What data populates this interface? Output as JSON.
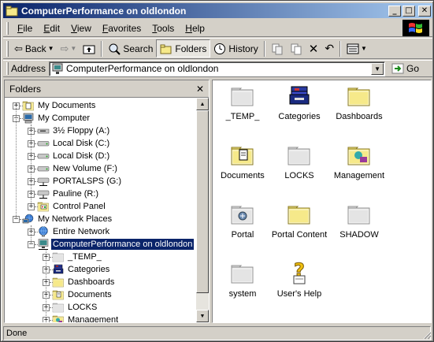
{
  "window": {
    "title": "ComputerPerformance on oldlondon",
    "minimize_glyph": "_",
    "maximize_glyph": "□",
    "close_glyph": "✕"
  },
  "menubar": {
    "items": [
      "File",
      "Edit",
      "View",
      "Favorites",
      "Tools",
      "Help"
    ],
    "underlined_letters": [
      "F",
      "E",
      "V",
      "a",
      "T",
      "H"
    ]
  },
  "toolbar": {
    "back_label": "Back",
    "search_label": "Search",
    "folders_label": "Folders",
    "history_label": "History"
  },
  "address": {
    "label": "Address",
    "value": "ComputerPerformance on oldlondon",
    "go_label": "Go"
  },
  "folders_pane": {
    "title": "Folders",
    "close_glyph": "✕",
    "tree": [
      {
        "label": "My Documents",
        "icon": "my-documents-icon",
        "expander": "+",
        "level": 0
      },
      {
        "label": "My Computer",
        "icon": "my-computer-icon",
        "expander": "−",
        "level": 0
      },
      {
        "label": "3½ Floppy (A:)",
        "icon": "floppy-drive-icon",
        "expander": "+",
        "level": 1
      },
      {
        "label": "Local Disk (C:)",
        "icon": "hard-drive-icon",
        "expander": "+",
        "level": 1
      },
      {
        "label": "Local Disk (D:)",
        "icon": "hard-drive-icon",
        "expander": "+",
        "level": 1
      },
      {
        "label": "New Volume (F:)",
        "icon": "hard-drive-icon",
        "expander": "+",
        "level": 1
      },
      {
        "label": "PORTALSPS (G:)",
        "icon": "network-drive-icon",
        "expander": "+",
        "level": 1
      },
      {
        "label": "Pauline (R:)",
        "icon": "network-drive-icon",
        "expander": "+",
        "level": 1
      },
      {
        "label": "Control Panel",
        "icon": "control-panel-icon",
        "expander": "+",
        "level": 1
      },
      {
        "label": "My Network Places",
        "icon": "network-places-icon",
        "expander": "−",
        "level": 0
      },
      {
        "label": "Entire Network",
        "icon": "globe-icon",
        "expander": "+",
        "level": 1
      },
      {
        "label": "ComputerPerformance on oldlondon",
        "icon": "network-share-icon",
        "expander": "−",
        "level": 1,
        "selected": true
      },
      {
        "label": "_TEMP_",
        "icon": "folder-icon",
        "expander": "+",
        "level": 2
      },
      {
        "label": "Categories",
        "icon": "categories-icon",
        "expander": "+",
        "level": 2
      },
      {
        "label": "Dashboards",
        "icon": "folder-icon",
        "expander": "+",
        "level": 2
      },
      {
        "label": "Documents",
        "icon": "documents-folder-icon",
        "expander": "+",
        "level": 2
      },
      {
        "label": "LOCKS",
        "icon": "folder-icon",
        "expander": "+",
        "level": 2
      },
      {
        "label": "Management",
        "icon": "management-folder-icon",
        "expander": "+",
        "level": 2
      }
    ]
  },
  "content": {
    "items": [
      {
        "label": "_TEMP_",
        "icon": "folder-icon",
        "style": "gray"
      },
      {
        "label": "Categories",
        "icon": "categories-icon",
        "style": "categories"
      },
      {
        "label": "Dashboards",
        "icon": "folder-icon",
        "style": "yellow"
      },
      {
        "label": "Documents",
        "icon": "documents-folder-icon",
        "style": "documents"
      },
      {
        "label": "LOCKS",
        "icon": "folder-icon",
        "style": "gray"
      },
      {
        "label": "Management",
        "icon": "management-folder-icon",
        "style": "management"
      },
      {
        "label": "Portal",
        "icon": "portal-folder-icon",
        "style": "portal"
      },
      {
        "label": "Portal Content",
        "icon": "folder-icon",
        "style": "yellow"
      },
      {
        "label": "SHADOW",
        "icon": "folder-icon",
        "style": "gray"
      },
      {
        "label": "system",
        "icon": "folder-icon",
        "style": "gray"
      },
      {
        "label": "User's Help",
        "icon": "help-icon",
        "style": "help"
      }
    ]
  },
  "statusbar": {
    "text": "Done"
  },
  "colors": {
    "titlebar_start": "#0a246a",
    "titlebar_end": "#a6caf0",
    "face": "#d4d0c8",
    "selection": "#0a246a",
    "folder_yellow": "#f6e98a",
    "folder_gray": "#e4e4e4"
  }
}
